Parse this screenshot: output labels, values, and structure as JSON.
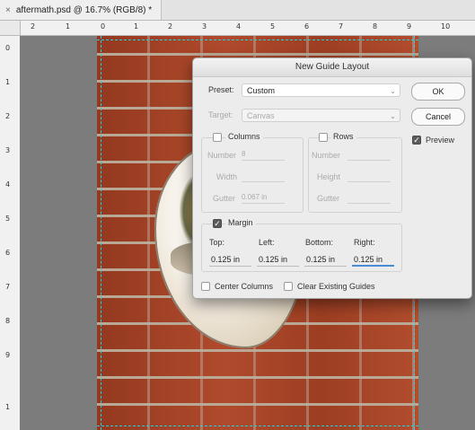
{
  "tab": {
    "close_glyph": "×",
    "title": "aftermath.psd @ 16.7% (RGB/8) *"
  },
  "ruler_top": [
    "2",
    "1",
    "0",
    "1",
    "2",
    "3",
    "4",
    "5",
    "6",
    "7",
    "8",
    "9",
    "10"
  ],
  "ruler_left": [
    "0",
    "1",
    "2",
    "3",
    "4",
    "5",
    "6",
    "7",
    "8",
    "9",
    "1"
  ],
  "dialog": {
    "title": "New Guide Layout",
    "preset_label": "Preset:",
    "preset_value": "Custom",
    "target_label": "Target:",
    "target_value": "Canvas",
    "ok_label": "OK",
    "cancel_label": "Cancel",
    "preview_label": "Preview",
    "columns": {
      "label": "Columns",
      "number_label": "Number",
      "number_value": "8",
      "width_label": "Width",
      "gutter_label": "Gutter",
      "gutter_value": "0.067 in"
    },
    "rows": {
      "label": "Rows",
      "number_label": "Number",
      "height_label": "Height",
      "gutter_label": "Gutter"
    },
    "margin": {
      "label": "Margin",
      "top_label": "Top:",
      "left_label": "Left:",
      "bottom_label": "Bottom:",
      "right_label": "Right:",
      "top": "0.125 in",
      "left": "0.125 in",
      "bottom": "0.125 in",
      "right": "0.125 in"
    },
    "center_columns_label": "Center Columns",
    "clear_guides_label": "Clear Existing Guides",
    "check_glyph": "✓"
  }
}
